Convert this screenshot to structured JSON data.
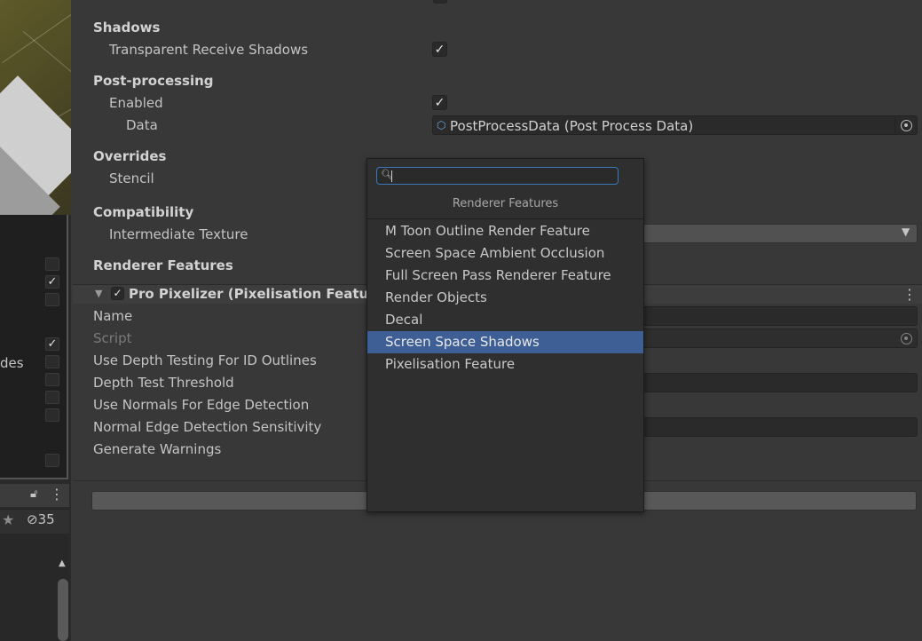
{
  "inspector": {
    "sections": {
      "shadows": "Shadows",
      "postprocessing": "Post-processing",
      "overrides": "Overrides",
      "compatibility": "Compatibility",
      "renderer_features": "Renderer Features"
    },
    "rows": {
      "transparent_receive_shadows": "Transparent Receive Shadows",
      "enabled": "Enabled",
      "data": "Data",
      "stencil": "Stencil",
      "intermediate_texture": "Intermediate Texture"
    },
    "post_process_data_value": "PostProcessData (Post Process Data)",
    "feature": {
      "title": "Pro Pixelizer (Pixelisation Feature)",
      "properties": {
        "name": "Name",
        "script": "Script",
        "use_depth_testing": "Use Depth Testing For ID Outlines",
        "depth_test_threshold": "Depth Test Threshold",
        "use_normals": "Use Normals For Edge Detection",
        "normal_edge_sensitivity": "Normal Edge Detection Sensitivity",
        "generate_warnings": "Generate Warnings"
      }
    }
  },
  "left": {
    "overlay_text": "des",
    "hidden_count": "35"
  },
  "popup": {
    "search_value": "",
    "header": "Renderer Features",
    "items": [
      "M Toon Outline Render Feature",
      "Screen Space Ambient Occlusion",
      "Full Screen Pass Renderer Feature",
      "Render Objects",
      "Decal",
      "Screen Space Shadows",
      "Pixelisation Feature"
    ],
    "selected_index": 5
  },
  "icons": {
    "checkmark": "checkmark-icon",
    "object_picker": "object-picker-icon",
    "search": "search-icon",
    "foldout": "foldout-arrow-icon",
    "lock": "lock-icon",
    "more": "more-vertical-icon",
    "star": "star-icon",
    "visibility": "visibility-off-icon"
  },
  "colors": {
    "selection": "#3e5f96",
    "focus_border": "#3a79bb"
  }
}
